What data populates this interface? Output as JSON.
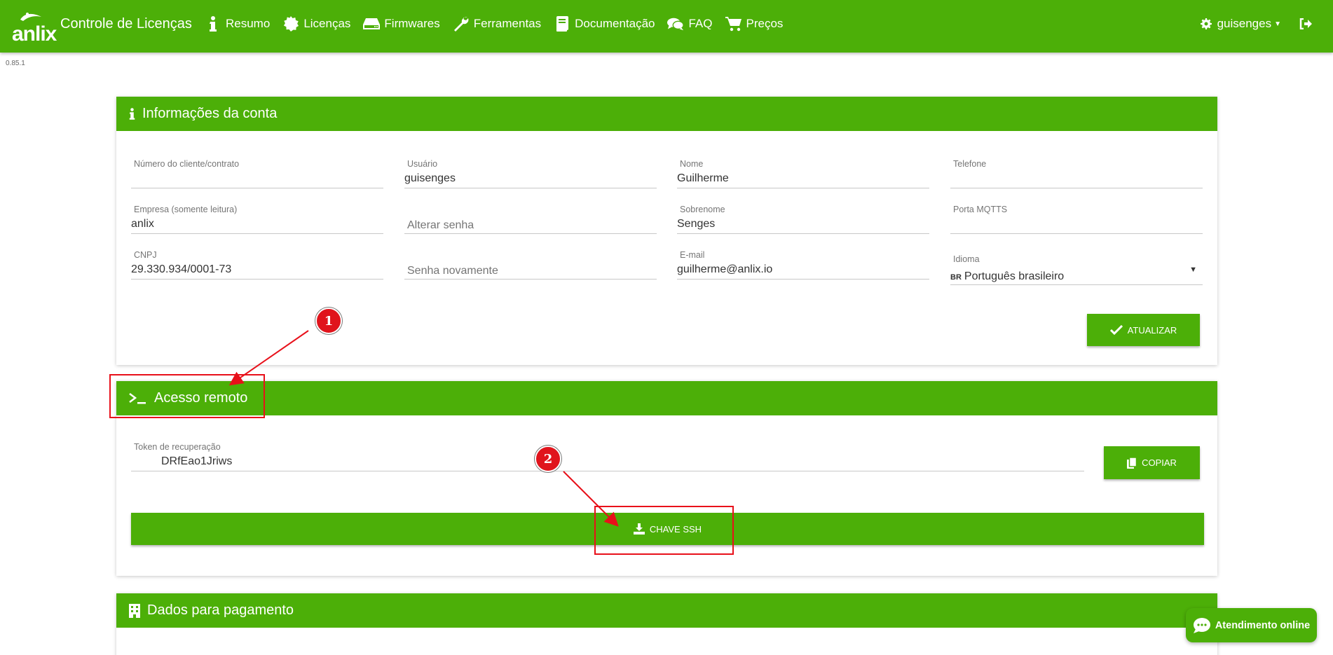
{
  "app": {
    "logo_text": "anlix",
    "title": "Controle de Licenças",
    "version": "0.85.1"
  },
  "nav": {
    "items": [
      {
        "label": "Resumo",
        "icon": "info-icon"
      },
      {
        "label": "Licenças",
        "icon": "badge-icon"
      },
      {
        "label": "Firmwares",
        "icon": "hdd-icon"
      },
      {
        "label": "Ferramentas",
        "icon": "wrench-icon"
      },
      {
        "label": "Documentação",
        "icon": "book-icon"
      },
      {
        "label": "FAQ",
        "icon": "comments-icon"
      },
      {
        "label": "Preços",
        "icon": "cart-icon"
      }
    ],
    "user": "guisenges"
  },
  "account": {
    "title": "Informações da conta",
    "fields": {
      "client_number": {
        "label": "Número do cliente/contrato",
        "value": ""
      },
      "username": {
        "label": "Usuário",
        "value": "guisenges"
      },
      "first_name": {
        "label": "Nome",
        "value": "Guilherme"
      },
      "phone": {
        "label": "Telefone",
        "value": ""
      },
      "company": {
        "label": "Empresa (somente leitura)",
        "value": "anlix"
      },
      "change_password": {
        "placeholder": "Alterar senha"
      },
      "last_name": {
        "label": "Sobrenome",
        "value": "Senges"
      },
      "mqtts_port": {
        "label": "Porta MQTTS",
        "value": ""
      },
      "cnpj": {
        "label": "CNPJ",
        "value": "29.330.934/0001-73"
      },
      "password_again": {
        "placeholder": "Senha novamente"
      },
      "email": {
        "label": "E-mail",
        "value": "guilherme@anlix.io"
      },
      "language": {
        "label": "Idioma",
        "flag": "BR",
        "value": "Português brasileiro"
      }
    },
    "update_button": "ATUALIZAR"
  },
  "remote": {
    "title": "Acesso remoto",
    "token_label": "Token de recuperação",
    "token_value": "DRfEao1Jriws",
    "copy_button": "COPIAR",
    "ssh_button": "CHAVE SSH"
  },
  "payment": {
    "title": "Dados para pagamento"
  },
  "annotations": {
    "marker1": "1",
    "marker2": "2",
    "color": "#e8101a"
  },
  "chat": {
    "label": "Atendimento online"
  },
  "colors": {
    "primary": "#4caf08"
  }
}
